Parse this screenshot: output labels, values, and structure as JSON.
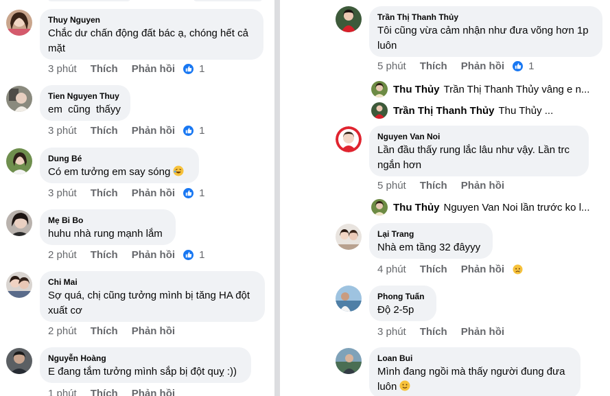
{
  "left_comments": [
    {
      "name": "Thuy Nguyen",
      "text_lines": [
        "Chắc dư chấn động đất bác ạ, chóng hết cả",
        "mặt"
      ],
      "time": "3 phút",
      "like": "Thích",
      "reply": "Phản hồi",
      "reactions": "1"
    },
    {
      "name": "Tien Nguyen Thuy",
      "text_lines": [
        "em  cũng  thấyy"
      ],
      "time": "3 phút",
      "like": "Thích",
      "reply": "Phản hồi",
      "reactions": "1"
    },
    {
      "name": "Dung Bé",
      "text_lines": [
        "Có em tưởng em say sóng"
      ],
      "time": "3 phút",
      "like": "Thích",
      "reply": "Phản hồi",
      "reactions": "1"
    },
    {
      "name": "Mẹ Bi Bo",
      "text_lines": [
        "huhu nhà rung mạnh lắm"
      ],
      "time": "2 phút",
      "like": "Thích",
      "reply": "Phản hồi",
      "reactions": "1"
    },
    {
      "name": "Chi Mai",
      "text_lines": [
        "Sợ quá, chị cũng tưởng mình bị tăng HA đột",
        "xuất cơ"
      ],
      "time": "2 phút",
      "like": "Thích",
      "reply": "Phản hồi",
      "reactions": ""
    },
    {
      "name": "Nguyễn Hoàng",
      "text_lines": [
        "E đang tắm tưởng mình sắp bị đột quỵ :))"
      ],
      "time": "1 phút",
      "like": "Thích",
      "reply": "Phản hồi",
      "reactions": ""
    }
  ],
  "right_comments": [
    {
      "name": "Trần Thị Thanh Thủy",
      "text_lines": [
        "Tôi cũng vừa cảm nhận như đưa võng hơn 1p",
        "luôn"
      ],
      "time": "5 phút",
      "like": "Thích",
      "reply": "Phản hồi",
      "reactions": "1"
    },
    {
      "name": "Nguyen Van Noi",
      "text_lines": [
        "Lần đầu thấy rung lắc lâu như vậy. Lần trc",
        "ngắn hơn"
      ],
      "time": "5 phút",
      "like": "Thích",
      "reply": "Phản hồi",
      "reactions": ""
    },
    {
      "name": "Lại Trang",
      "text_lines": [
        "Nhà em tầng 32 đâyyy"
      ],
      "time": "4 phút",
      "like": "Thích",
      "reply": "Phản hồi",
      "reactions": ""
    },
    {
      "name": "Phong Tuấn",
      "text_lines": [
        "Độ 2-5p"
      ],
      "time": "3 phút",
      "like": "Thích",
      "reply": "Phản hồi",
      "reactions": ""
    },
    {
      "name": "Loan Bui",
      "text_lines": [
        "Mình đang ngồi mà thấy người đung đưa",
        "luôn"
      ],
      "time": "",
      "like": "",
      "reply": "",
      "reactions": ""
    }
  ],
  "reply_previews": [
    {
      "name": "Thu Thủy",
      "preview": "Trần Thị Thanh Thủy vâng e n..."
    },
    {
      "name": "Trần Thị Thanh Thủy",
      "preview": "Thu Thủy ..."
    },
    {
      "name": "Thu Thủy",
      "preview": "Nguyen Van Noi lần trước ko l..."
    }
  ],
  "colors": {
    "bubble": "#f0f2f5",
    "meta": "#65676b",
    "like_blue": "#1877f2",
    "divider": "#dcdde0"
  },
  "icons": [
    "like-reaction-icon",
    "laugh-emoji-icon",
    "sad-emoji-icon",
    "slight-smile-emoji-icon"
  ]
}
